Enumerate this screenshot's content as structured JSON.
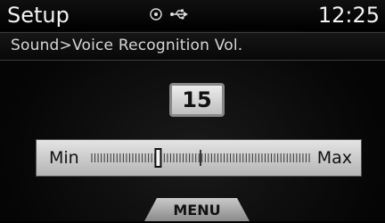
{
  "status_bar": {
    "title": "Setup",
    "time": "12:25",
    "icons": [
      "disc-icon",
      "usb-icon"
    ]
  },
  "breadcrumb": {
    "text": "Sound>Voice Recognition Vol."
  },
  "volume": {
    "value": "15",
    "min_label": "Min",
    "max_label": "Max",
    "level": 15,
    "max_level": 30
  },
  "bottom": {
    "menu_label": "MENU"
  },
  "colors": {
    "background": "#000000",
    "panel_light": "#dcdcdc",
    "text_light": "#f2f2f2",
    "text_dark": "#111111"
  }
}
